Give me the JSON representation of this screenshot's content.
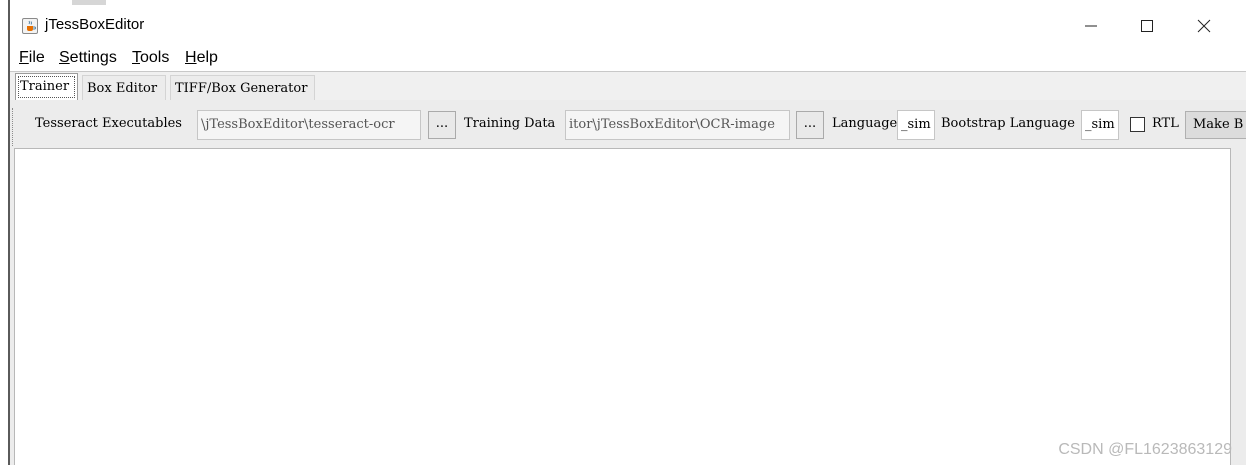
{
  "window": {
    "title": "jTessBoxEditor",
    "icon": "java-cup-icon"
  },
  "menu": [
    {
      "mnemonic": "F",
      "rest": "ile"
    },
    {
      "mnemonic": "S",
      "rest": "ettings"
    },
    {
      "mnemonic": "T",
      "rest": "ools"
    },
    {
      "mnemonic": "H",
      "rest": "elp"
    }
  ],
  "tabs": [
    {
      "label": "Trainer",
      "selected": true
    },
    {
      "label": "Box Editor",
      "selected": false
    },
    {
      "label": "TIFF/Box Generator",
      "selected": false
    }
  ],
  "trainer": {
    "executables_label": "Tesseract Executables",
    "executables_value": "\\jTessBoxEditor\\tesseract-ocr",
    "browse_label": "...",
    "training_data_label": "Training Data",
    "training_data_value": "itor\\jTessBoxEditor\\OCR-image",
    "browse2_label": "...",
    "language_label": "Language",
    "language_value": "_sim",
    "bootstrap_label": "Bootstrap Language",
    "bootstrap_value": "_sim",
    "rtl_label": "RTL",
    "rtl_checked": false,
    "make_label": "Make B"
  },
  "watermark": "CSDN @FL1623863129"
}
